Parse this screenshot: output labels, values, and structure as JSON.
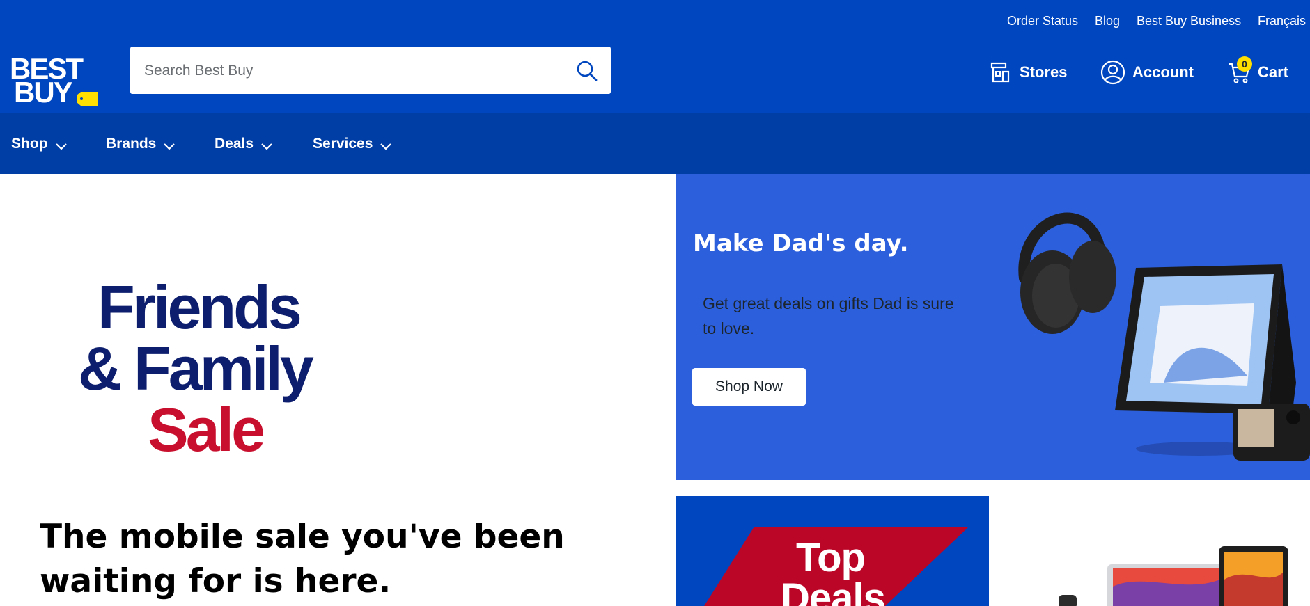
{
  "utility_nav": [
    "Order Status",
    "Blog",
    "Best Buy Business",
    "Français"
  ],
  "logo": {
    "line1": "BEST",
    "line2": "BUY",
    "tag_color": "#ffe000"
  },
  "search": {
    "placeholder": "Search Best Buy",
    "value": "",
    "icon": "search-icon"
  },
  "header_actions": {
    "stores": {
      "label": "Stores",
      "icon": "store-icon"
    },
    "account": {
      "label": "Account",
      "icon": "account-icon"
    },
    "cart": {
      "label": "Cart",
      "icon": "cart-icon",
      "count": "0"
    }
  },
  "main_nav": [
    "Shop",
    "Brands",
    "Deals",
    "Services"
  ],
  "promo_left": {
    "line1": "Friends",
    "line2": "& Family",
    "line3": "Sale",
    "headline": "The mobile sale you've been waiting for is here."
  },
  "promo_dad": {
    "title": "Make Dad's day.",
    "text": "Get great deals on gifts Dad is sure to love.",
    "button": "Shop Now"
  },
  "top_deals": {
    "line1": "Top",
    "line2": "Deals"
  },
  "colors": {
    "brand_blue": "#0046be",
    "nav_blue": "#003da5",
    "promo_blue": "#2c5fdb",
    "brand_yellow": "#ffe000",
    "navy": "#0e1e6e",
    "red": "#c8102e"
  }
}
